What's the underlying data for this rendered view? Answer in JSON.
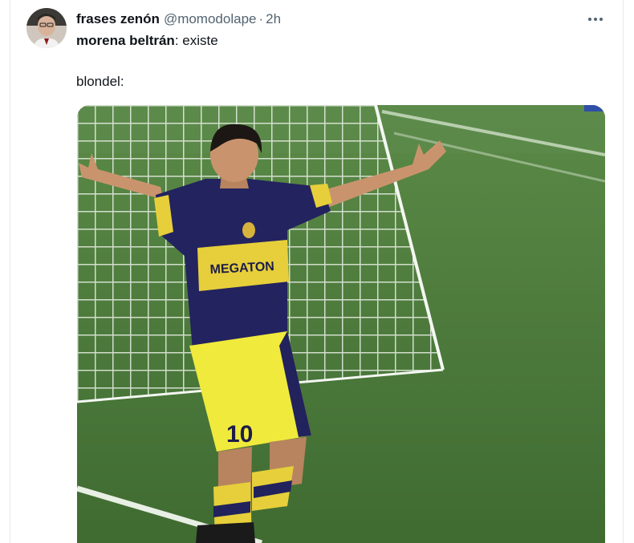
{
  "tweet": {
    "author": {
      "display_name": "frases zenón",
      "handle": "@momodolape",
      "separator": "·",
      "time": "2h",
      "avatar": "avatar-photo"
    },
    "more_icon": "more-horizontal-icon",
    "text": {
      "line1_speaker": "morena beltrán",
      "line1_text": ": existe",
      "line2": "blondel:"
    },
    "media": {
      "type": "photo",
      "jersey_sponsor": "MEGATON",
      "shorts_number": "10"
    }
  },
  "colors": {
    "text_primary": "#0f1419",
    "text_secondary": "#536471",
    "border": "#e7e9ea",
    "pitch_green": "#4d7a3a",
    "jersey_navy": "#23235f",
    "jersey_yellow": "#e6cf3a",
    "shorts_yellow": "#f0ea3c"
  }
}
